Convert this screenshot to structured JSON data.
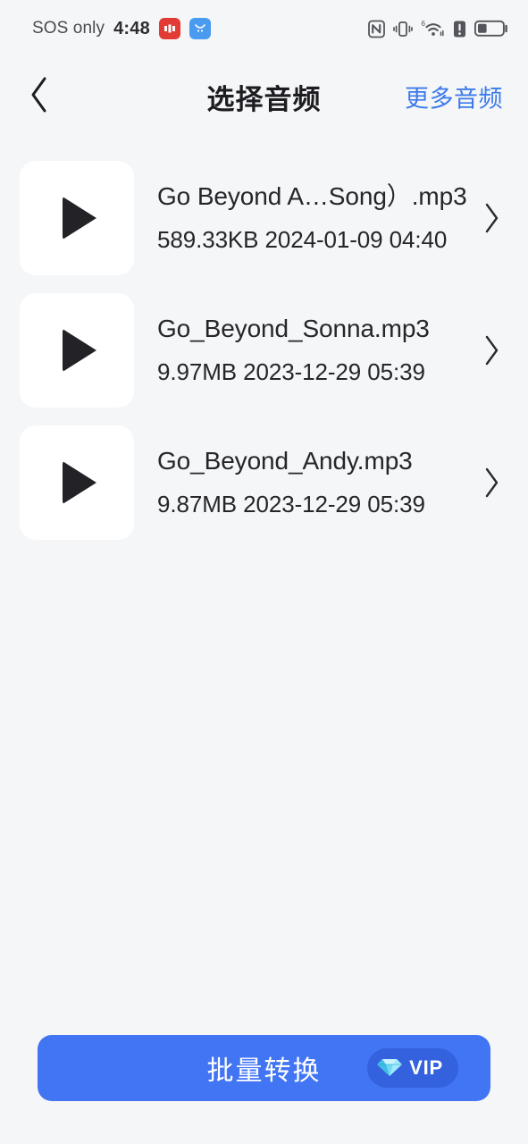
{
  "status_bar": {
    "carrier": "SOS only",
    "time": "4:48",
    "notifications": [
      {
        "name": "red-app-notification",
        "color": "#e23b35"
      },
      {
        "name": "blue-app-notification",
        "color": "#4a9bf0"
      }
    ],
    "icons": [
      {
        "name": "nfc-icon"
      },
      {
        "name": "vibrate-icon"
      },
      {
        "name": "wifi-6-icon",
        "label": "6"
      },
      {
        "name": "signal-alert-icon"
      },
      {
        "name": "battery-icon",
        "level": 35
      }
    ]
  },
  "header": {
    "back_icon": "chevron-left-icon",
    "title": "选择音频",
    "more_link": "更多音频"
  },
  "audio_list": [
    {
      "title": "Go Beyond A…Song）.mp3",
      "meta": "589.33KB 2024-01-09 04:40",
      "thumb_icon": "play-icon",
      "chevron_icon": "chevron-right-icon"
    },
    {
      "title": "Go_Beyond_Sonna.mp3",
      "meta": "9.97MB 2023-12-29 05:39",
      "thumb_icon": "play-icon",
      "chevron_icon": "chevron-right-icon"
    },
    {
      "title": "Go_Beyond_Andy.mp3",
      "meta": "9.87MB 2023-12-29 05:39",
      "thumb_icon": "play-icon",
      "chevron_icon": "chevron-right-icon"
    }
  ],
  "bottom": {
    "convert_label": "批量转换",
    "vip_label": "VIP",
    "vip_icon": "diamond-icon",
    "button_color": "#4175f4",
    "badge_color": "#3461dd"
  },
  "theme": {
    "page_background": "#f5f6f8",
    "card_background": "#ffffff",
    "accent_blue": "#3d7bea",
    "text_primary": "#25252a"
  }
}
